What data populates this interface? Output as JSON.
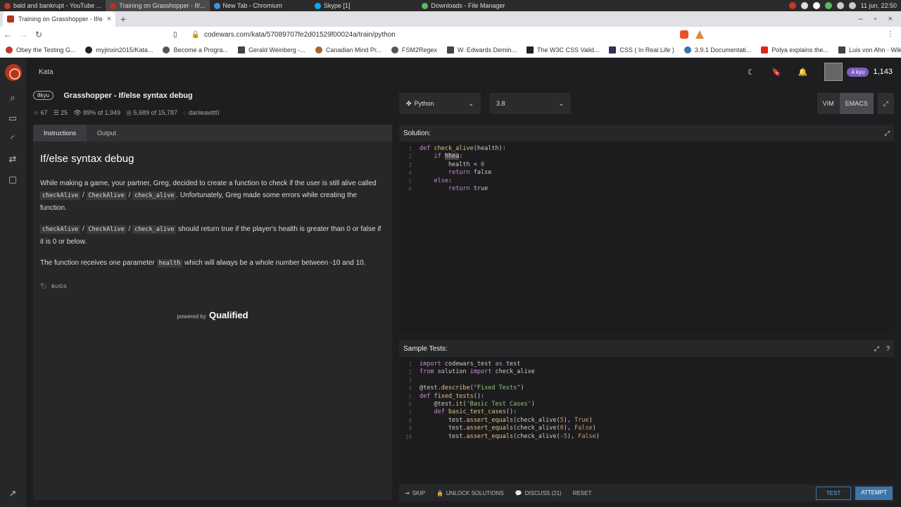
{
  "taskbar": {
    "apps": [
      {
        "label": "bald and bankrupt - YouTube ...",
        "color": "#c0392b",
        "active": false
      },
      {
        "label": "Training on Grasshopper - If/...",
        "color": "#b1361e",
        "active": true
      },
      {
        "label": "New Tab - Chromium",
        "color": "#4a90d9",
        "active": false
      },
      {
        "label": "Skype [1]",
        "color": "#00aff0",
        "active": false
      },
      {
        "label": "Downloads - File Manager",
        "color": "#5cb85c",
        "active": false
      }
    ],
    "clock": "11 jun, 22:50"
  },
  "browser": {
    "tab_title": "Training on Grasshopper - If/e",
    "url": "codewars.com/kata/57089707fe2d01529f00024a/train/python",
    "bookmarks": [
      "Obey the Testing G...",
      "myjinxin2015/Kata...",
      "Become a Progra...",
      "Gerald Weinberg -...",
      "Canadian Mind Pr...",
      "FSM2Regex",
      "W. Edwards Demin...",
      "The W3C CSS Valid...",
      "CSS ( In Real Life )",
      "3.9.1 Documentati...",
      "Polya explains the...",
      "Luis von Ahn - Wiki..."
    ]
  },
  "header": {
    "crumb": "Kata",
    "rank": "4 kyu",
    "honor": "1,143"
  },
  "kata": {
    "kyu": "8kyu",
    "title": "Grasshopper - If/else syntax debug",
    "stars": "67",
    "votes": "25",
    "satisfaction": "89% of 1,949",
    "completed": "5,689 of 15,787",
    "author": "danleavitt0"
  },
  "left_panel": {
    "tab_instructions": "Instructions",
    "tab_output": "Output",
    "heading": "If/else syntax debug",
    "p1_a": "While making a game, your partner, Greg, decided to create a function to check if the user is still alive called ",
    "p1_code1": "checkAlive",
    "p1_sep1": " / ",
    "p1_code2": "CheckAlive",
    "p1_sep2": " / ",
    "p1_code3": "check_alive",
    "p1_b": ". Unfortunately, Greg made some errors while creating the function.",
    "p2_code1": "checkAlive",
    "p2_sep1": " / ",
    "p2_code2": "CheckAlive",
    "p2_sep2": " / ",
    "p2_code3": "check_alive",
    "p2_b": " should return true if the player's health is greater than 0 or false if it is 0 or below.",
    "p3_a": "The function receives one parameter ",
    "p3_code": "health",
    "p3_b": " which will always be a whole number between -10 and 10.",
    "tag": "BUGS",
    "powered_by": "powered by",
    "qualified": "Qualified"
  },
  "editor": {
    "language": "Python",
    "version": "3.8",
    "mode_vim": "VIM",
    "mode_emacs": "EMACS",
    "solution_label": "Solution:",
    "tests_label": "Sample Tests:"
  },
  "bottom_bar": {
    "skip": "SKIP",
    "unlock": "UNLOCK SOLUTIONS",
    "discuss": "DISCUSS (21)",
    "reset": "RESET",
    "test": "TEST",
    "attempt": "ATTEMPT"
  }
}
